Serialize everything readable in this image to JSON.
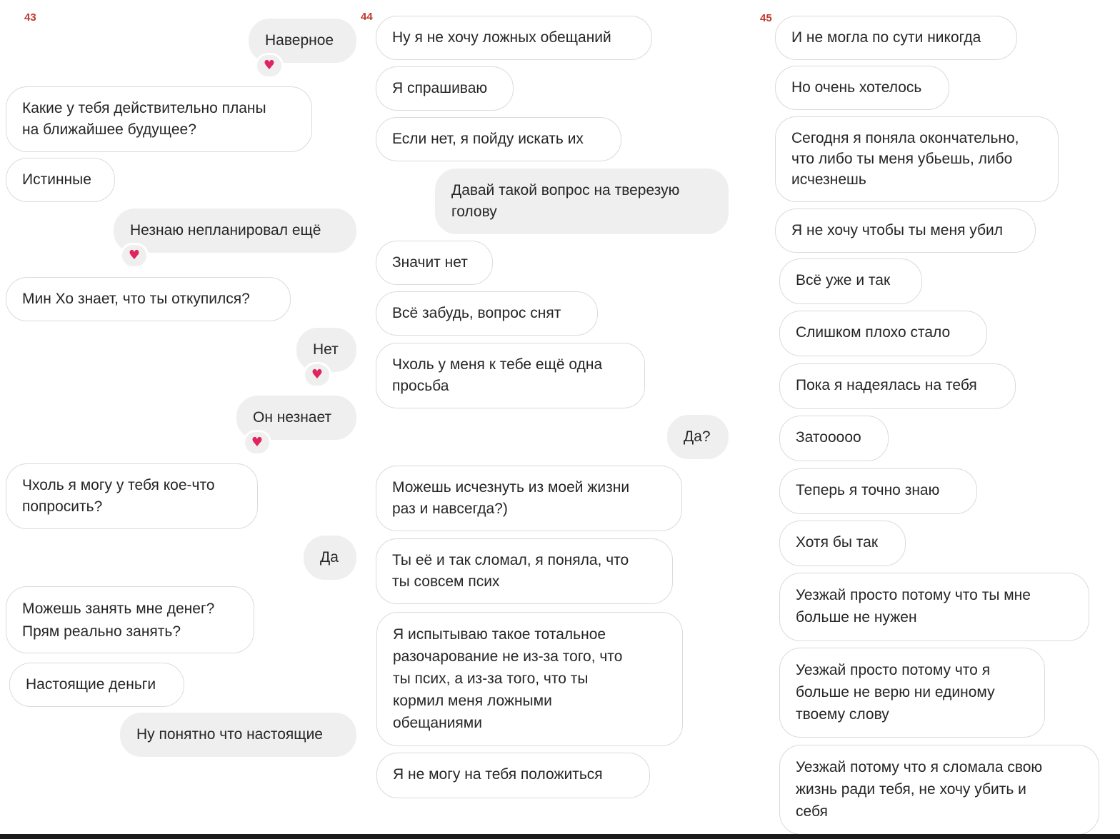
{
  "pages": [
    {
      "number": "43",
      "messages": [
        {
          "text": "Наверное",
          "reaction": "heart"
        },
        {
          "text": "Какие у тебя действительно планы\nна ближайшее будущее?"
        },
        {
          "text": "Истинные"
        },
        {
          "text": "Незнаю непланировал ещё",
          "reaction": "heart"
        },
        {
          "text": "Мин Хо знает, что ты откупился?"
        },
        {
          "text": "Нет",
          "reaction": "heart"
        },
        {
          "text": "Он незнает",
          "reaction": "heart"
        },
        {
          "text": "Чхоль я могу у тебя кое-что\nпопросить?"
        },
        {
          "text": "Да"
        },
        {
          "text": "Можешь занять мне денег?\nПрям реально занять?"
        },
        {
          "text": "Настоящие деньги"
        },
        {
          "text": "Ну понятно что настоящие"
        }
      ]
    },
    {
      "number": "44",
      "messages": [
        {
          "text": "Ну я не хочу ложных обещаний"
        },
        {
          "text": "Я спрашиваю"
        },
        {
          "text": "Если нет, я пойду искать их"
        },
        {
          "text": "Давай такой вопрос на тверезую\nголову"
        },
        {
          "text": "Значит нет"
        },
        {
          "text": "Всё забудь, вопрос снят"
        },
        {
          "text": "Чхоль у меня к тебе ещё одна\nпросьба"
        },
        {
          "text": "Да?"
        },
        {
          "text": "Можешь исчезнуть из моей жизни\nраз и навсегда?)"
        },
        {
          "text": "Ты её и так сломал, я поняла, что\nты совсем псих"
        },
        {
          "text": "Я испытываю такое тотальное\nразочарование не из-за того, что\nты псих, а из-за того, что ты\nкормил меня ложными\nобещаниями"
        },
        {
          "text": "Я не могу на тебя положиться"
        }
      ]
    },
    {
      "number": "45",
      "messages": [
        {
          "text": "И не могла по сути никогда"
        },
        {
          "text": "Но очень хотелось"
        },
        {
          "text": "Сегодня я поняла окончательно,\nчто либо ты меня убьешь, либо\nисчезнешь"
        },
        {
          "text": "Я не хочу чтобы ты меня убил"
        },
        {
          "text": "Всё уже и так"
        },
        {
          "text": "Слишком плохо стало"
        },
        {
          "text": "Пока я надеялась на тебя"
        },
        {
          "text": "Затооооо"
        },
        {
          "text": "Теперь я точно знаю"
        },
        {
          "text": "Хотя бы так"
        },
        {
          "text": "Уезжай просто потому что ты мне\nбольше не нужен"
        },
        {
          "text": "Уезжай просто потому что я\nбольше не верю ни единому\nтвоему слову"
        },
        {
          "text": "Уезжай потому что я сломала свою\nжизнь ради тебя, не хочу убить и\nсебя"
        }
      ]
    }
  ],
  "reaction_icon": "heart-icon",
  "colors": {
    "incoming_bg": "#ffffff",
    "incoming_border": "#dbdbdb",
    "outgoing_bg": "#efefef",
    "page_number": "#c0392b",
    "heart": "#e0245e"
  }
}
